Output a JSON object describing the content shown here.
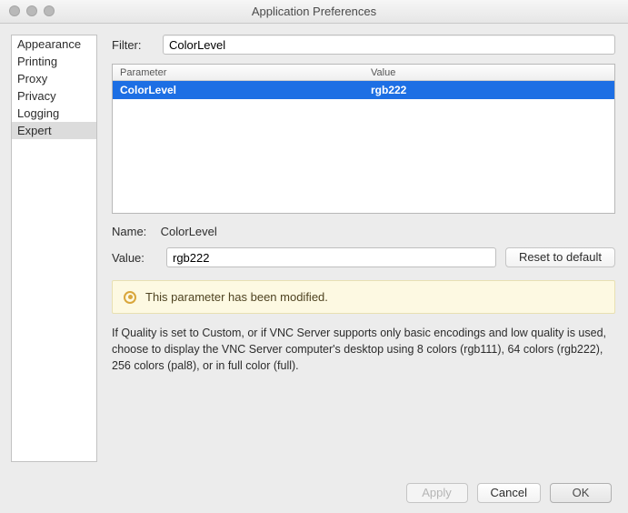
{
  "window": {
    "title": "Application Preferences"
  },
  "sidebar": {
    "items": [
      {
        "label": "Appearance"
      },
      {
        "label": "Printing"
      },
      {
        "label": "Proxy"
      },
      {
        "label": "Privacy"
      },
      {
        "label": "Logging"
      },
      {
        "label": "Expert"
      }
    ],
    "selected_index": 5
  },
  "filter": {
    "label": "Filter:",
    "value": "ColorLevel"
  },
  "table": {
    "headers": {
      "param": "Parameter",
      "value": "Value"
    },
    "rows": [
      {
        "param": "ColorLevel",
        "value": "rgb222"
      }
    ],
    "selected_index": 0
  },
  "detail": {
    "name_label": "Name:",
    "name_value": "ColorLevel",
    "value_label": "Value:",
    "value_value": "rgb222",
    "reset_label": "Reset to default"
  },
  "notice": {
    "text": "This parameter has been modified."
  },
  "description": {
    "text": "If Quality is set to Custom, or if VNC Server supports only basic encodings and low quality is used, choose to display the VNC Server computer's desktop using 8 colors (rgb111), 64 colors (rgb222), 256 colors (pal8), or in full color (full)."
  },
  "footer": {
    "apply": "Apply",
    "cancel": "Cancel",
    "ok": "OK"
  }
}
